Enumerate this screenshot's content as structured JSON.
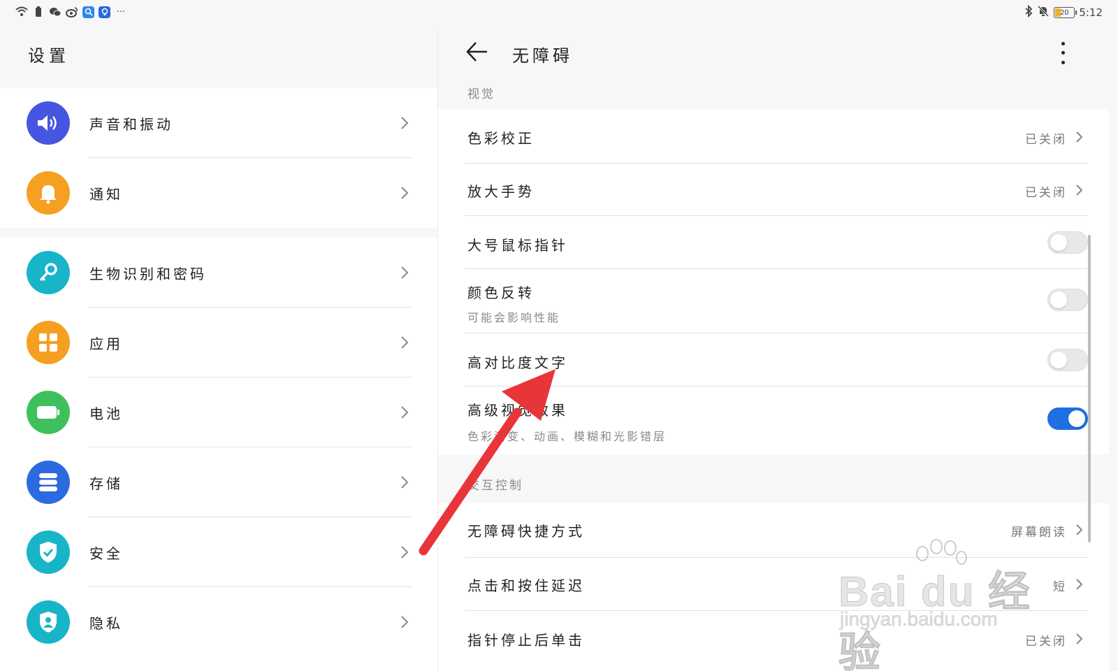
{
  "status_bar": {
    "left_icons": [
      "wifi-icon",
      "battery-saver-icon",
      "wechat-icon",
      "weibo-icon",
      "search-app-icon",
      "bulb-app-icon"
    ],
    "more": "···",
    "right_icons": [
      "bluetooth-icon",
      "mute-icon"
    ],
    "battery": "20",
    "time": "5:12"
  },
  "left": {
    "title": "设置",
    "items": [
      {
        "label": "声音和振动",
        "icon": "speaker-icon",
        "color": "#4656e0"
      },
      {
        "label": "通知",
        "icon": "bell-icon",
        "color": "#f5a020"
      },
      {
        "label": "生物识别和密码",
        "icon": "key-icon",
        "color": "#18b5c8"
      },
      {
        "label": "应用",
        "icon": "apps-grid-icon",
        "color": "#f5a020"
      },
      {
        "label": "电池",
        "icon": "battery-icon",
        "color": "#3ec15c"
      },
      {
        "label": "存储",
        "icon": "storage-icon",
        "color": "#2c6ae0"
      },
      {
        "label": "安全",
        "icon": "shield-check-icon",
        "color": "#18b5c8"
      },
      {
        "label": "隐私",
        "icon": "privacy-icon",
        "color": "#18b5c8"
      }
    ]
  },
  "right": {
    "title": "无障碍",
    "sections": [
      {
        "label": "视觉",
        "rows": [
          {
            "title": "色彩校正",
            "value": "已关闭"
          },
          {
            "title": "放大手势",
            "value": "已关闭"
          },
          {
            "title": "大号鼠标指针",
            "toggle": false
          },
          {
            "title": "颜色反转",
            "subtitle": "可能会影响性能",
            "toggle": false
          },
          {
            "title": "高对比度文字",
            "toggle": false
          },
          {
            "title": "高级视觉效果",
            "subtitle": "色彩渐变、动画、模糊和光影错层",
            "toggle": true
          }
        ]
      },
      {
        "label": "交互控制",
        "rows": [
          {
            "title": "无障碍快捷方式",
            "value": "屏幕朗读"
          },
          {
            "title": "点击和按住延迟",
            "value": "短"
          },
          {
            "title": "指针停止后单击",
            "value": "已关闭"
          }
        ]
      }
    ]
  },
  "watermark": {
    "brand": "Bai du 经验",
    "url": "jingyan.baidu.com"
  },
  "colors": {
    "accent": "#1f6fe0",
    "annotation_arrow": "#e8353a"
  }
}
